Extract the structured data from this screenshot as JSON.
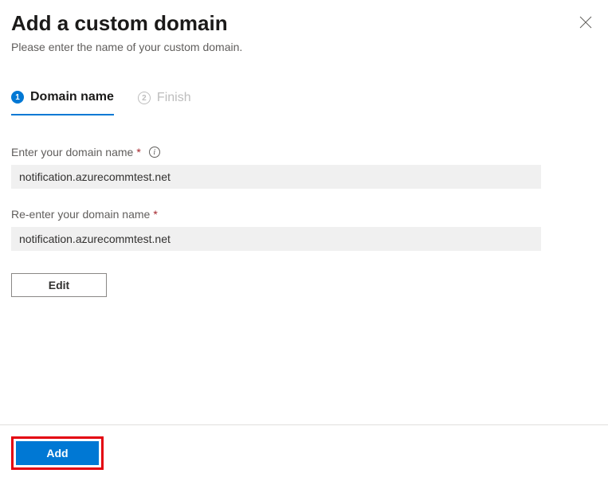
{
  "header": {
    "title": "Add a custom domain",
    "subtitle": "Please enter the name of your custom domain."
  },
  "wizard": {
    "step1": {
      "num": "1",
      "label": "Domain name"
    },
    "step2": {
      "num": "2",
      "label": "Finish"
    }
  },
  "form": {
    "domain": {
      "label": "Enter your domain name",
      "value": "notification.azurecommtest.net"
    },
    "confirm": {
      "label": "Re-enter your domain name",
      "value": "notification.azurecommtest.net"
    },
    "edit_label": "Edit"
  },
  "footer": {
    "add_label": "Add"
  }
}
